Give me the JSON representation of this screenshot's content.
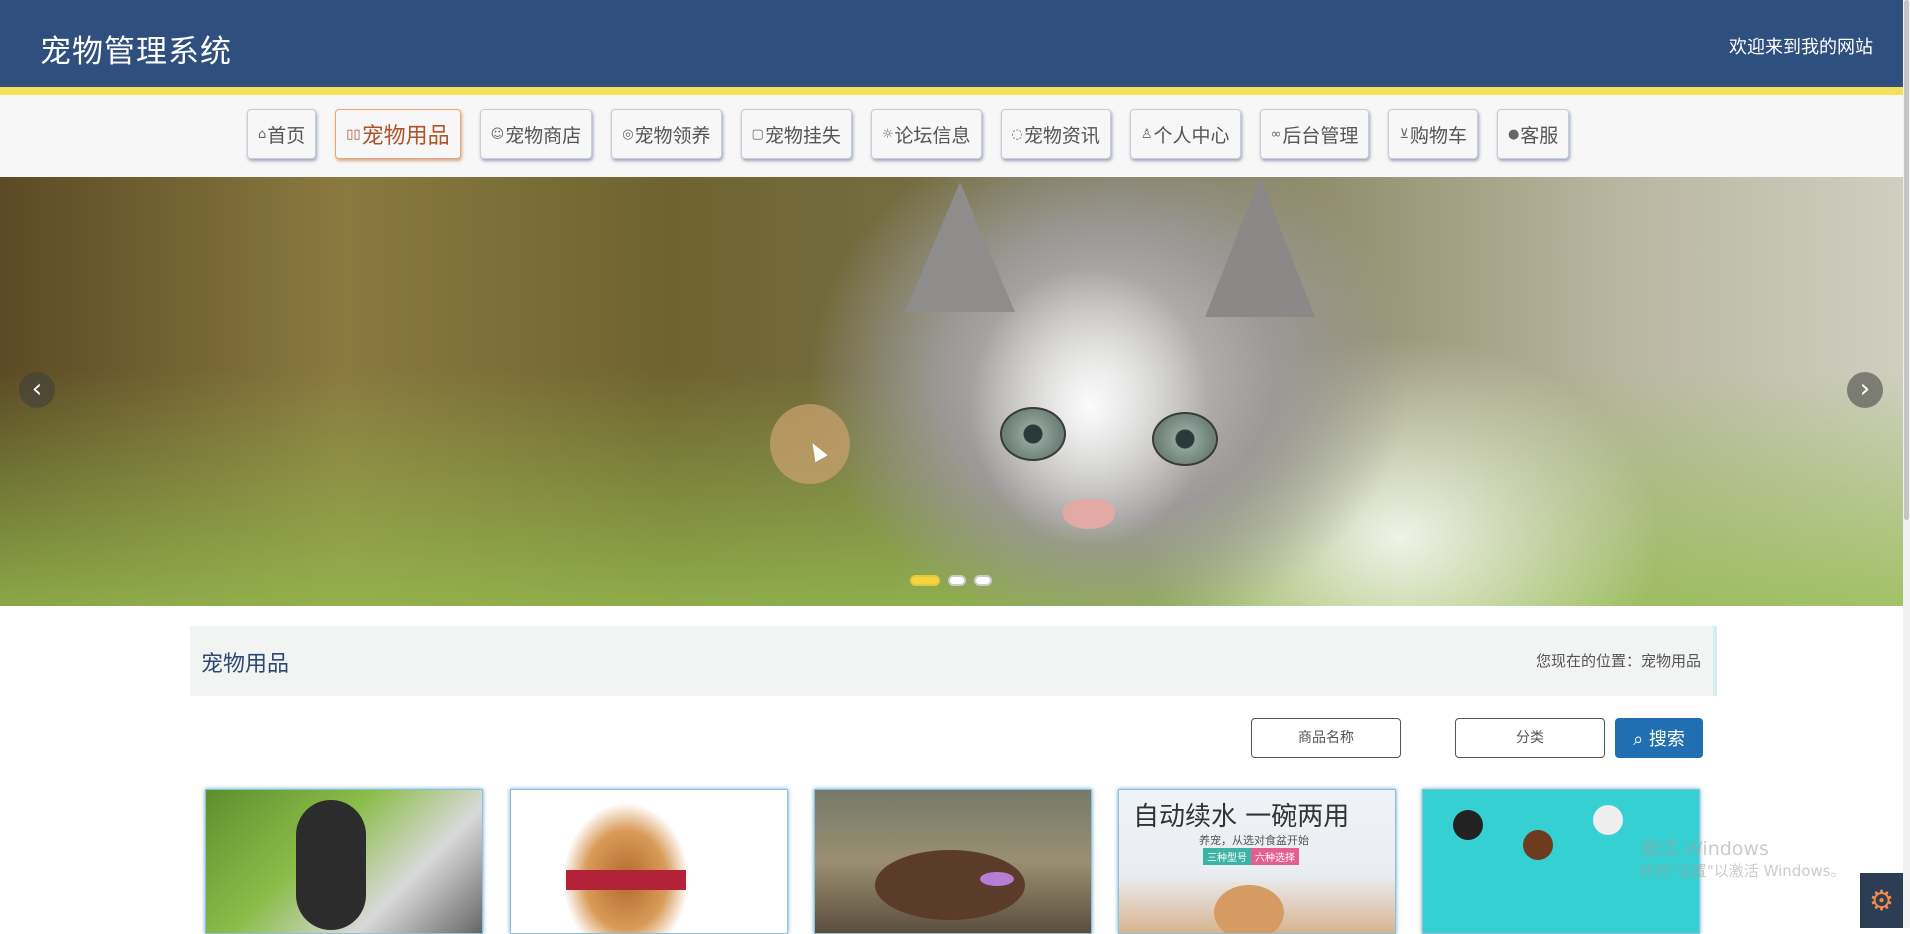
{
  "header": {
    "site_title": "宠物管理系统",
    "welcome": "欢迎来到我的网站"
  },
  "nav": {
    "items": [
      {
        "label": "首页",
        "icon": "home-icon"
      },
      {
        "label": "宠物用品",
        "icon": "goods-icon",
        "active": true
      },
      {
        "label": "宠物商店",
        "icon": "store-icon"
      },
      {
        "label": "宠物领养",
        "icon": "adopt-icon"
      },
      {
        "label": "宠物挂失",
        "icon": "lost-icon"
      },
      {
        "label": "论坛信息",
        "icon": "forum-icon"
      },
      {
        "label": "宠物资讯",
        "icon": "news-icon"
      },
      {
        "label": "个人中心",
        "icon": "user-icon"
      },
      {
        "label": "后台管理",
        "icon": "link-icon"
      },
      {
        "label": "购物车",
        "icon": "cart-icon"
      },
      {
        "label": "客服",
        "icon": "service-icon"
      }
    ]
  },
  "carousel": {
    "prev": "‹",
    "next": "›",
    "slides_count": 3,
    "active_index": 0
  },
  "section": {
    "title": "宠物用品",
    "breadcrumb_prefix": "您现在的位置：",
    "breadcrumb_current": "宠物用品"
  },
  "search": {
    "name_placeholder": "商品名称",
    "category_placeholder": "分类",
    "button_label": "搜索"
  },
  "products": {
    "p4_title": "自动续水 一碗两用",
    "p4_sub": "养宠，从选对食盆开始",
    "p4_tag1": "三种型号",
    "p4_tag2": "六种选择"
  },
  "watermark": {
    "line1": "激活 Windows",
    "line2": "转到\"设置\"以激活 Windows。"
  },
  "colors": {
    "header_bg": "#2f4f7f",
    "header_accent": "#f5e05a",
    "active_nav": "#b0532a",
    "search_button": "#1f6fb2"
  }
}
